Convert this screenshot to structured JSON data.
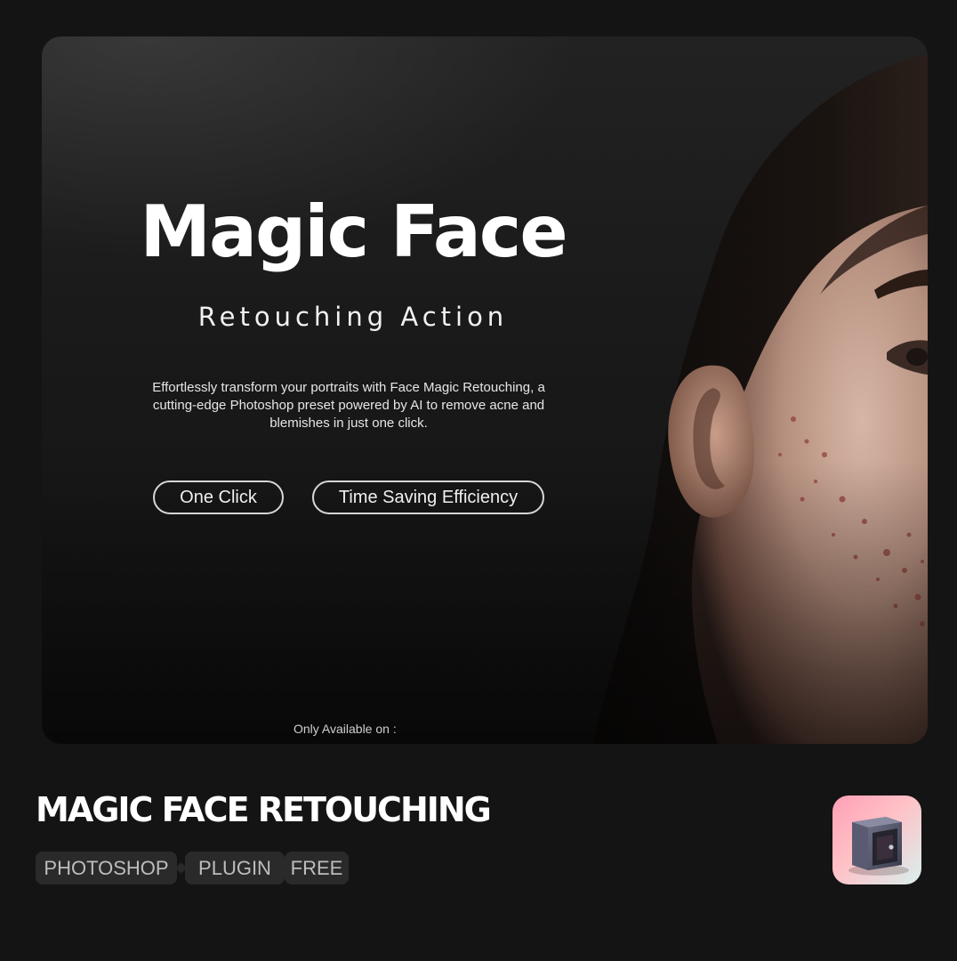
{
  "banner": {
    "title": "Magic Face",
    "subtitle": "Retouching Action",
    "description": "Effortlessly transform your portraits with Face Magic Retouching, a cutting-edge Photoshop preset powered by AI to remove acne and blemishes in just one click.",
    "features": [
      "One Click",
      "Time Saving Efficiency"
    ],
    "availability_text": "Only Available on :"
  },
  "product": {
    "title": "MAGIC FACE RETOUCHING",
    "tags": [
      "PHOTOSHOP",
      "PLUGIN",
      "FREE"
    ]
  },
  "icons": {
    "app_icon": "safe-icon"
  },
  "colors": {
    "background": "#141414",
    "banner_dark": "#191919",
    "tag_background": "#2a2a2a",
    "tag_text": "#bdbdbd",
    "text_primary": "#ffffff",
    "icon_pink": "#ff9fb6",
    "icon_mint": "#d9f0ee"
  }
}
